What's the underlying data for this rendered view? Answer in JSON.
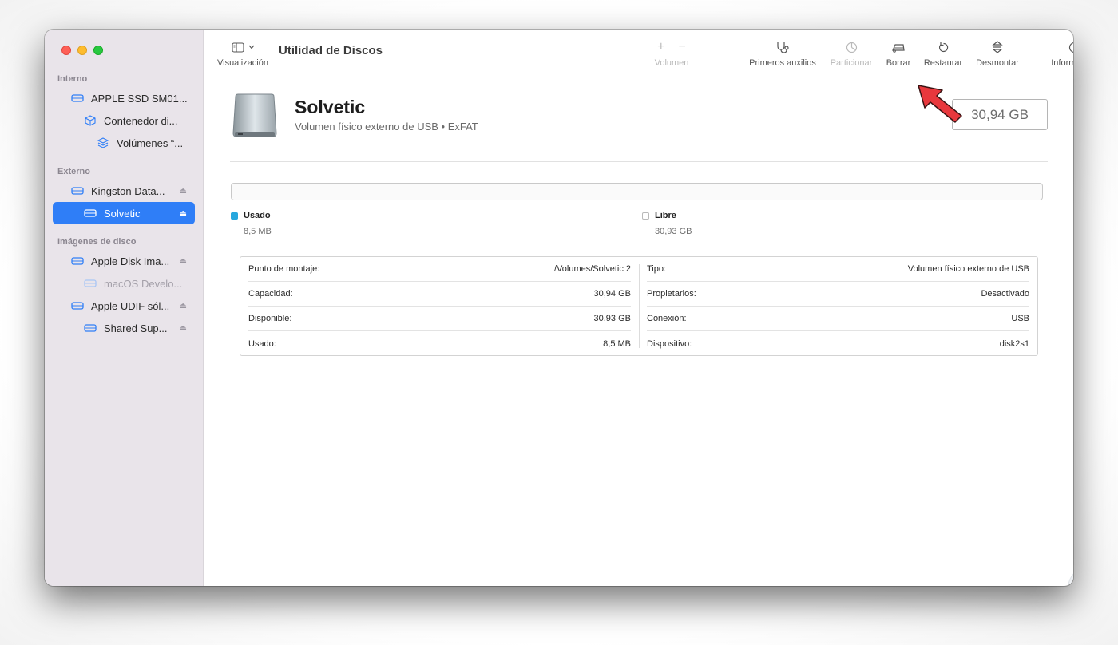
{
  "window": {
    "title": "Utilidad de Discos",
    "view_label": "Visualización"
  },
  "toolbar": {
    "volume_label": "Volumen",
    "first_aid_label": "Primeros auxilios",
    "partition_label": "Particionar",
    "erase_label": "Borrar",
    "restore_label": "Restaurar",
    "unmount_label": "Desmontar",
    "info_label": "Información"
  },
  "sidebar": {
    "section_internal": "Interno",
    "section_external": "Externo",
    "section_images": "Imágenes de disco",
    "items": [
      {
        "label": "APPLE SSD SM01...",
        "icon": "drive-icon"
      },
      {
        "label": "Contenedor di...",
        "icon": "container-icon"
      },
      {
        "label": "Volúmenes “...",
        "icon": "layers-icon"
      },
      {
        "label": "Kingston Data...",
        "icon": "drive-icon"
      },
      {
        "label": "Solvetic",
        "icon": "drive-icon"
      },
      {
        "label": "Apple Disk Ima...",
        "icon": "drive-icon"
      },
      {
        "label": "macOS Develo...",
        "icon": "drive-icon"
      },
      {
        "label": "Apple UDIF sól...",
        "icon": "drive-icon"
      },
      {
        "label": "Shared Sup...",
        "icon": "drive-icon"
      }
    ]
  },
  "volume": {
    "name": "Solvetic",
    "subtitle": "Volumen físico externo de USB • ExFAT",
    "capacity": "30,94 GB",
    "used_fraction": 0.0003
  },
  "usage": {
    "used_label": "Usado",
    "used_value": "8,5 MB",
    "used_color": "#26a7de",
    "free_label": "Libre",
    "free_value": "30,93 GB"
  },
  "info_left": [
    {
      "key": "Punto de montaje:",
      "value": "/Volumes/Solvetic 2"
    },
    {
      "key": "Capacidad:",
      "value": "30,94 GB"
    },
    {
      "key": "Disponible:",
      "value": "30,93 GB"
    },
    {
      "key": "Usado:",
      "value": "8,5 MB"
    }
  ],
  "info_right": [
    {
      "key": "Tipo:",
      "value": "Volumen físico externo de USB"
    },
    {
      "key": "Propietarios:",
      "value": "Desactivado"
    },
    {
      "key": "Conexión:",
      "value": "USB"
    },
    {
      "key": "Dispositivo:",
      "value": "disk2s1"
    }
  ],
  "colors": {
    "accent": "#2f7ef7",
    "sidebar_bg": "#e9e4ea",
    "arrow": "#e8383d"
  }
}
